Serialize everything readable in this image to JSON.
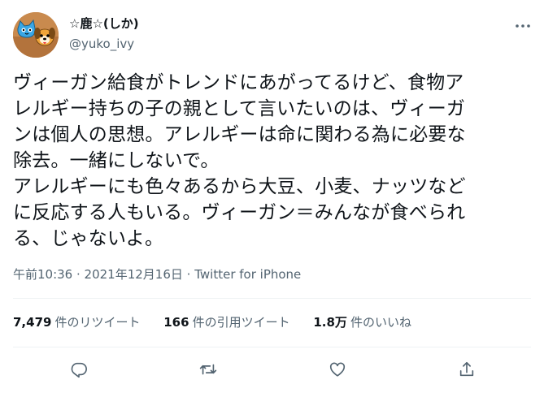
{
  "author": {
    "display_name": "☆鹿☆(しか)",
    "handle": "@yuko_ivy"
  },
  "icons": {
    "more": "more-dots-icon",
    "reply": "reply-icon",
    "retweet": "retweet-icon",
    "like": "heart-icon",
    "share": "share-icon"
  },
  "tweet": {
    "lines": [
      "ヴィーガン給食がトレンドにあがってるけど、食物ア",
      "レルギー持ちの子の親として言いたいのは、ヴィーガ",
      "ンは個人の思想。アレルギーは命に関わる為に必要な",
      "除去。一緒にしないで。",
      "アレルギーにも色々あるから大豆、小麦、ナッツなど",
      "に反応する人もいる。ヴィーガン＝みんなが食べられ",
      "る、じゃないよ。"
    ]
  },
  "meta": {
    "time": "午前10:36",
    "separator1": " · ",
    "date": "2021年12月16日",
    "separator2": " · ",
    "source": "Twitter for iPhone"
  },
  "stats": {
    "retweets_count": "7,479",
    "retweets_label": "件のリツイート",
    "quotes_count": "166",
    "quotes_label": "件の引用ツイート",
    "likes_count": "1.8万",
    "likes_label": "件のいいね"
  },
  "colors": {
    "text": "#0f1419",
    "secondary": "#536471",
    "divider": "#eff3f4"
  }
}
